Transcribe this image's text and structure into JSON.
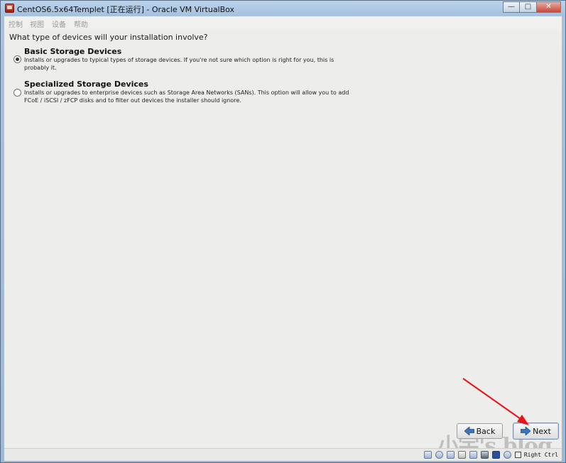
{
  "window": {
    "title": "CentOS6.5x64Templet [正在运行] - Oracle VM VirtualBox",
    "minimize_glyph": "—",
    "maximize_glyph": "□",
    "close_glyph": "✕"
  },
  "menubar": {
    "items": [
      {
        "label": "控制"
      },
      {
        "label": "视图"
      },
      {
        "label": "设备"
      },
      {
        "label": "帮助"
      }
    ]
  },
  "installer": {
    "question": "What type of devices will your installation involve?",
    "options": [
      {
        "title": "Basic Storage Devices",
        "description": "Installs or upgrades to typical types of storage devices.  If you're not sure which option is right for you, this is probably it.",
        "selected": true
      },
      {
        "title": "Specialized Storage Devices",
        "description": "Installs or upgrades to enterprise devices such as Storage Area Networks (SANs). This option will allow you to add FCoE / iSCSI / zFCP disks and to filter out devices the installer should ignore.",
        "selected": false
      }
    ],
    "back_label": "Back",
    "next_label": "Next"
  },
  "watermark": {
    "text": "小宇's blog"
  },
  "statusbar": {
    "icons": [
      "hard-disk-icon",
      "optical-drive-icon",
      "network-icon",
      "usb-icon",
      "shared-folders-icon",
      "display-icon",
      "virtualization-icon",
      "mouse-integration-icon"
    ],
    "host_key": "Right Ctrl"
  },
  "colors": {
    "annotation_arrow": "#e8141b",
    "content_bg": "#ededeb",
    "window_frame": "#a6c2df"
  }
}
